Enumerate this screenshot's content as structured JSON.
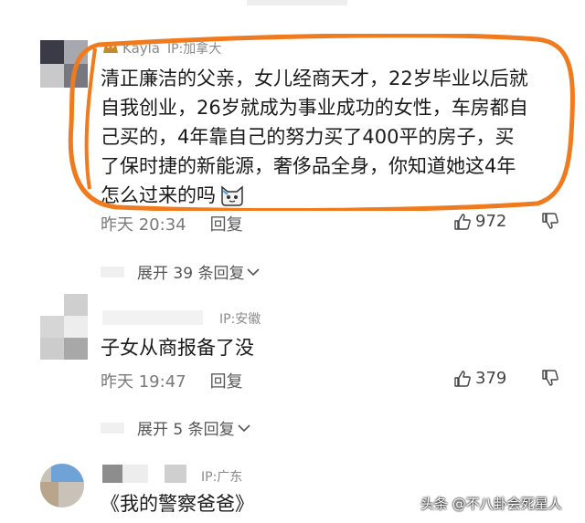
{
  "comments": [
    {
      "username": "Kayla",
      "ip": "IP:加拿大",
      "text_lines": [
        "清正廉洁的父亲，女儿经商天才，22岁毕业以后就",
        "自我创业，26岁就成为事业成功的女性，车房都自",
        "己买的，4年靠自己的努力买了400平的房子，买",
        "了保时捷的新能源，奢侈品全身，你知道她这4年",
        "怎么过来的吗"
      ],
      "time": "昨天 20:34",
      "reply_label": "回复",
      "likes": "972",
      "expand_label": "展开 39 条回复"
    },
    {
      "ip": "IP:安徽",
      "text": "子女从商报备了没",
      "time": "昨天 19:47",
      "reply_label": "回复",
      "likes": "379",
      "expand_label": "展开 5 条回复"
    },
    {
      "ip": "IP:广东",
      "text": "《我的警察爸爸》"
    }
  ],
  "watermark": "头条 @不八卦会死星人",
  "colors": {
    "annotation": "#f07a1e",
    "text": "#1a1a1a",
    "meta": "#7a7a7a"
  },
  "icons": [
    "thumbs-up-icon",
    "thumbs-down-icon",
    "chevron-down-icon",
    "cat-emoji-icon",
    "crown-icon"
  ]
}
